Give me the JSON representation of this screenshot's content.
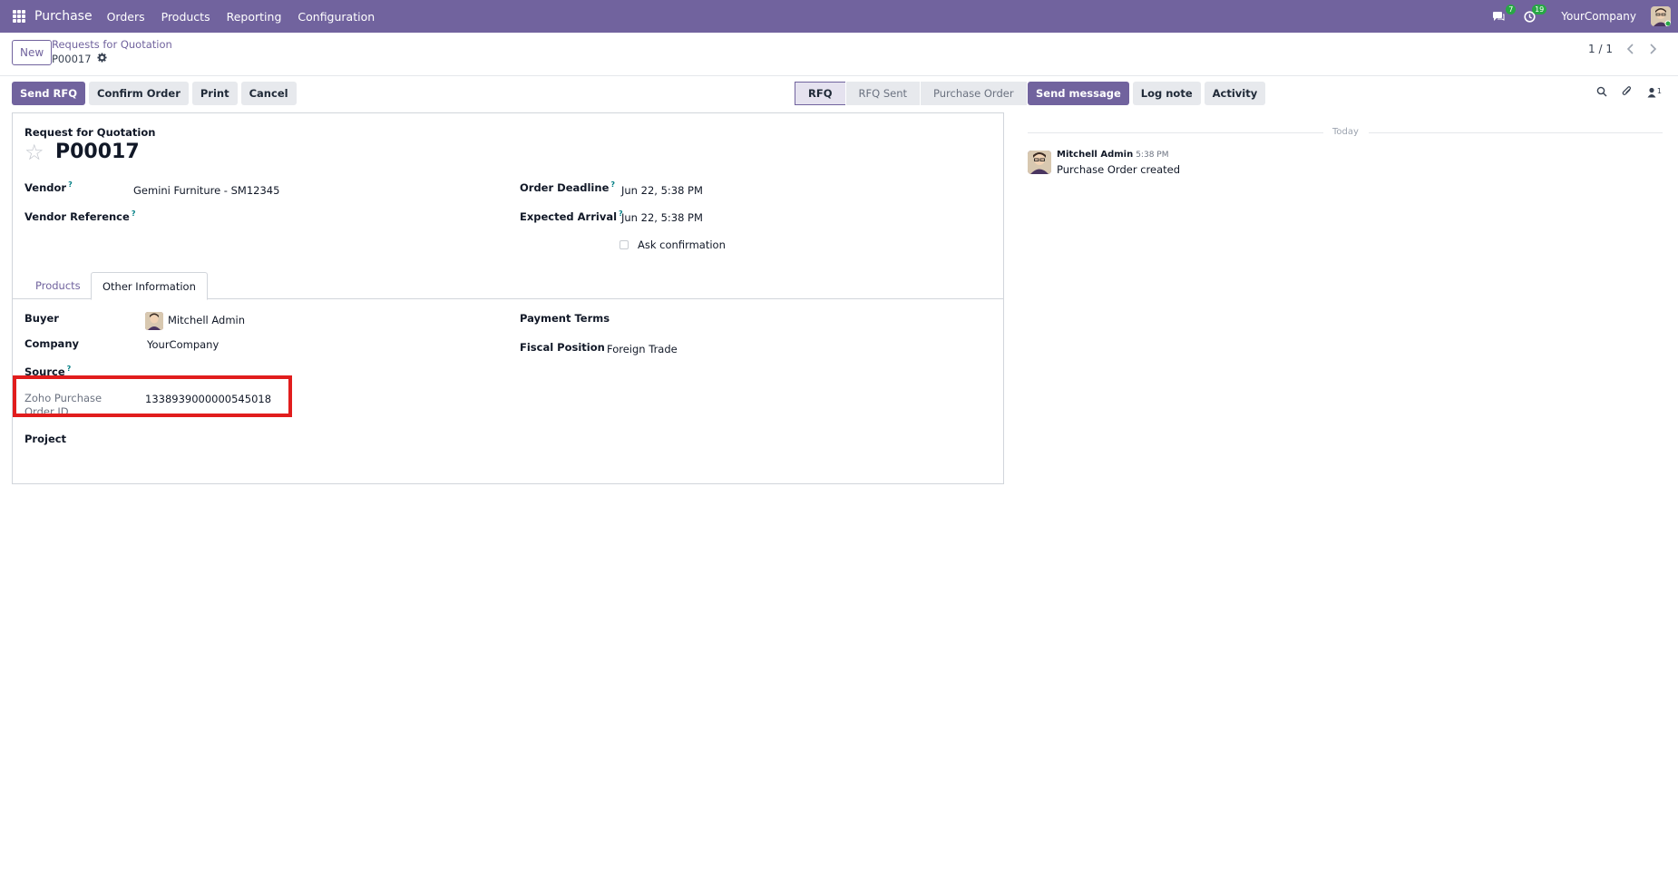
{
  "nav": {
    "app": "Purchase",
    "menu": [
      "Orders",
      "Products",
      "Reporting",
      "Configuration"
    ],
    "messages_badge": "7",
    "activities_badge": "19",
    "company": "YourCompany"
  },
  "control": {
    "new_label": "New",
    "breadcrumb_parent": "Requests for Quotation",
    "breadcrumb_current": "P00017",
    "pager": "1 / 1"
  },
  "actions": {
    "send_rfq": "Send RFQ",
    "confirm": "Confirm Order",
    "print": "Print",
    "cancel": "Cancel"
  },
  "status": {
    "steps": [
      "RFQ",
      "RFQ Sent",
      "Purchase Order"
    ],
    "active": "RFQ"
  },
  "form": {
    "title_label": "Request for Quotation",
    "title": "P00017",
    "vendor_label": "Vendor",
    "vendor_value": "Gemini Furniture - SM12345",
    "vendor_ref_label": "Vendor Reference",
    "order_deadline_label": "Order Deadline",
    "order_deadline_value": "Jun 22, 5:38 PM",
    "expected_arrival_label": "Expected Arrival",
    "expected_arrival_value": "Jun 22, 5:38 PM",
    "ask_confirmation_label": "Ask confirmation",
    "help_mark": "?"
  },
  "tabs": [
    "Products",
    "Other Information"
  ],
  "other_info": {
    "buyer_label": "Buyer",
    "buyer_value": "Mitchell Admin",
    "company_label": "Company",
    "company_value": "YourCompany",
    "source_label": "Source",
    "zoho_label": "Zoho Purchase Order ID",
    "zoho_value": "1338939000000545018",
    "project_label": "Project",
    "payment_terms_label": "Payment Terms",
    "fiscal_position_label": "Fiscal Position",
    "fiscal_position_value": "Foreign Trade"
  },
  "chatter": {
    "send_message": "Send message",
    "log_note": "Log note",
    "activity": "Activity",
    "followers_count": "1",
    "today": "Today",
    "message_author": "Mitchell Admin",
    "message_time": "5:38 PM",
    "message_body": "Purchase Order created"
  },
  "colors": {
    "brand": "#71639e",
    "highlight": "#e11d1d",
    "badge": "#28a745"
  }
}
